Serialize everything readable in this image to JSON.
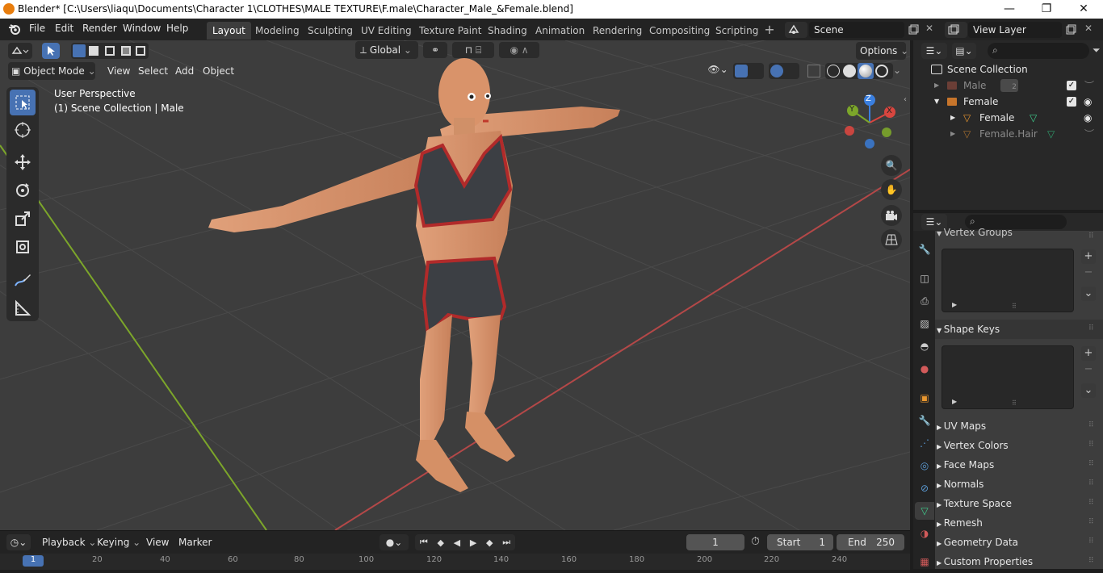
{
  "title_bar": {
    "title": "Blender* [C:\\Users\\liaqu\\Documents\\Character 1\\CLOTHES\\MALE TEXTURE\\F.male\\Character_Male_&Female.blend]",
    "minimize": "—",
    "maximize": "❐",
    "close": "✕"
  },
  "menus": [
    "File",
    "Edit",
    "Render",
    "Window",
    "Help"
  ],
  "workspaces": [
    "Layout",
    "Modeling",
    "Sculpting",
    "UV Editing",
    "Texture Paint",
    "Shading",
    "Animation",
    "Rendering",
    "Compositing",
    "Scripting"
  ],
  "scene": "Scene",
  "view_layer": "View Layer",
  "viewport_header": {
    "mode": "Object Mode",
    "menus": [
      "View",
      "Select",
      "Add",
      "Object"
    ],
    "transform": "Global",
    "options": "Options"
  },
  "viewport_info": {
    "line1": "User Perspective",
    "line2": "(1) Scene Collection | Male"
  },
  "gizmo": {
    "x": "X",
    "y": "Y",
    "z": "Z"
  },
  "outliner": {
    "root": "Scene Collection",
    "items": [
      {
        "label": "Male",
        "badge": "2"
      },
      {
        "label": "Female"
      },
      {
        "label": "Female"
      },
      {
        "label": "Female.Hair"
      }
    ]
  },
  "properties": {
    "sections": [
      "Vertex Groups",
      "Shape Keys",
      "UV Maps",
      "Vertex Colors",
      "Face Maps",
      "Normals",
      "Texture Space",
      "Remesh",
      "Geometry Data",
      "Custom Properties"
    ]
  },
  "timeline": {
    "menus": [
      "Playback",
      "Keying",
      "View",
      "Marker"
    ],
    "current_frame": "1",
    "start_label": "Start",
    "start": "1",
    "end_label": "End",
    "end": "250",
    "ruler": [
      "1",
      "20",
      "40",
      "60",
      "80",
      "100",
      "120",
      "140",
      "160",
      "180",
      "200",
      "220",
      "240"
    ]
  },
  "colors": {
    "accent": "#4772b3",
    "x_axis": "#d8463f",
    "y_axis": "#7ca62a",
    "z_axis": "#3a7fe0",
    "skin": "#d9936a",
    "outfit": "#3c3f44",
    "trim": "#b12a2a"
  }
}
